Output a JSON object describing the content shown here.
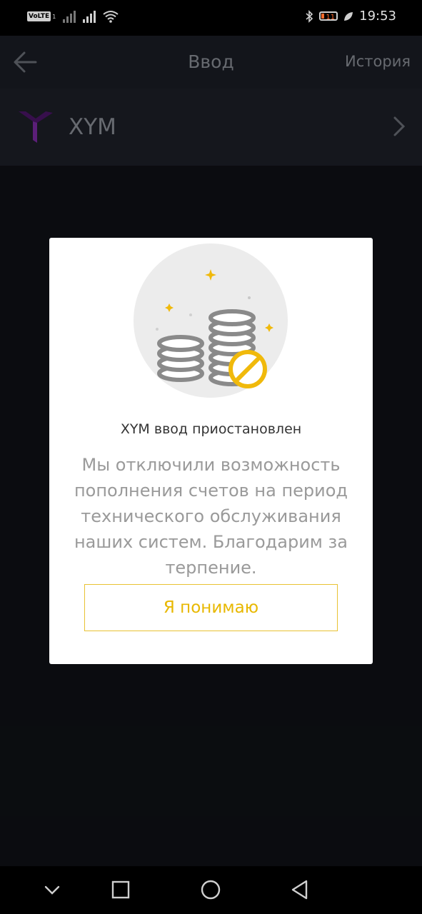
{
  "status_bar": {
    "volte": "VoLTE",
    "volte_sub": "1",
    "battery_level": "11",
    "time": "19:53",
    "icons": [
      "signal-icon",
      "signal-icon",
      "wifi-icon",
      "bluetooth-icon",
      "battery-icon",
      "leaf-icon"
    ]
  },
  "app_bar": {
    "title": "Ввод",
    "history_label": "История"
  },
  "asset": {
    "name": "XYM",
    "logo_color": "#5a1a7a"
  },
  "dialog": {
    "title": "XYM ввод приостановлен",
    "message": "Мы отключили возможность пополнения счетов на период технического обслуживания наших систем. Благодарим за терпение.",
    "button_label": "Я понимаю",
    "accent_color": "#f0b90b"
  },
  "nav_bar": {
    "icons": [
      "chevron-down-icon",
      "square-icon",
      "circle-icon",
      "triangle-back-icon"
    ]
  }
}
